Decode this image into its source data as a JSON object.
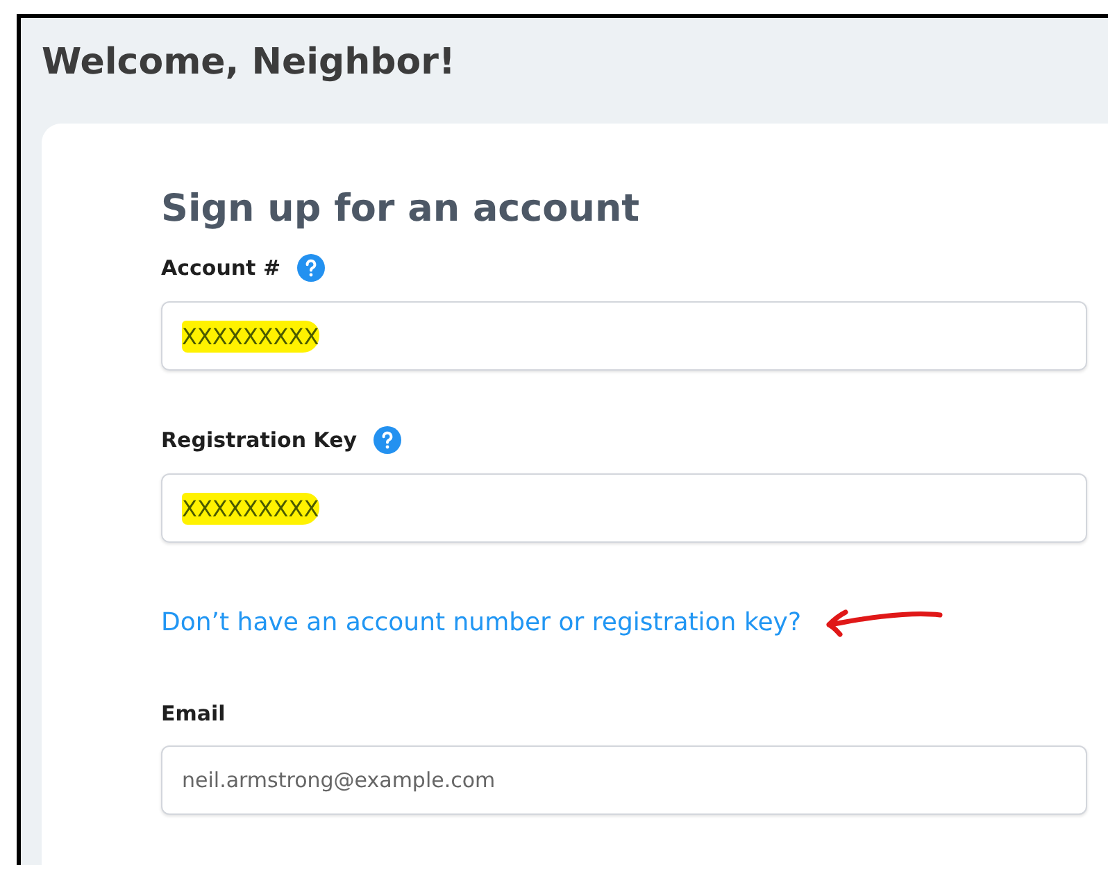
{
  "page": {
    "title": "Welcome, Neighbor!"
  },
  "form": {
    "title": "Sign up for an account",
    "fields": [
      {
        "label": "Account #",
        "help": true,
        "value": "XXXXXXXXX",
        "highlighted": true
      },
      {
        "label": "Registration Key",
        "help": true,
        "value": "XXXXXXXXX",
        "highlighted": true
      }
    ],
    "help_link": {
      "text": "Don’t have an account number or registration key?",
      "annotated": true
    },
    "email": {
      "label": "Email",
      "placeholder": "neil.armstrong@example.com"
    }
  }
}
